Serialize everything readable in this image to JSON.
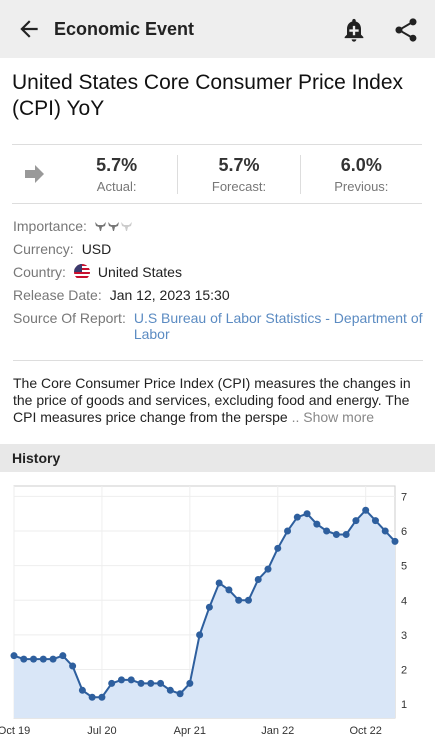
{
  "appbar": {
    "title": "Economic Event"
  },
  "event": {
    "title": "United States Core Consumer Price Index (CPI) YoY",
    "actual": "5.7%",
    "actual_label": "Actual:",
    "forecast": "5.7%",
    "forecast_label": "Forecast:",
    "previous": "6.0%",
    "previous_label": "Previous:"
  },
  "details": {
    "importance_label": "Importance:",
    "currency_label": "Currency:",
    "currency": "USD",
    "country_label": "Country:",
    "country": "United States",
    "release_label": "Release Date:",
    "release_date": "Jan 12, 2023 15:30",
    "source_label": "Source Of Report:",
    "source": "U.S Bureau of Labor Statistics - Department of Labor"
  },
  "description": {
    "text": "The Core Consumer Price Index (CPI) measures the changes in the price of goods and services, excluding food and energy. The CPI measures price change from the perspe",
    "ellipsis": " .. ",
    "more": "Show more"
  },
  "history": {
    "label": "History"
  },
  "colors": {
    "accent": "#2e5f9e",
    "fill": "#d9e6f7",
    "link": "#5b8bc2"
  },
  "chart_data": {
    "type": "area",
    "x_tick_labels": [
      "Oct 19",
      "Jul 20",
      "Apr 21",
      "Jan 22",
      "Oct 22"
    ],
    "x_tick_index": [
      0,
      9,
      18,
      27,
      36
    ],
    "values": [
      2.4,
      2.3,
      2.3,
      2.3,
      2.3,
      2.4,
      2.1,
      1.4,
      1.2,
      1.2,
      1.6,
      1.7,
      1.7,
      1.6,
      1.6,
      1.6,
      1.4,
      1.3,
      1.6,
      3.0,
      3.8,
      4.5,
      4.3,
      4.0,
      4.0,
      4.6,
      4.9,
      5.5,
      6.0,
      6.4,
      6.5,
      6.2,
      6.0,
      5.9,
      5.9,
      6.3,
      6.6,
      6.3,
      6.0,
      5.7
    ],
    "y_ticks": [
      1,
      2,
      3,
      4,
      5,
      6,
      7
    ],
    "ylim": [
      0.6,
      7.3
    ],
    "grid": true
  }
}
